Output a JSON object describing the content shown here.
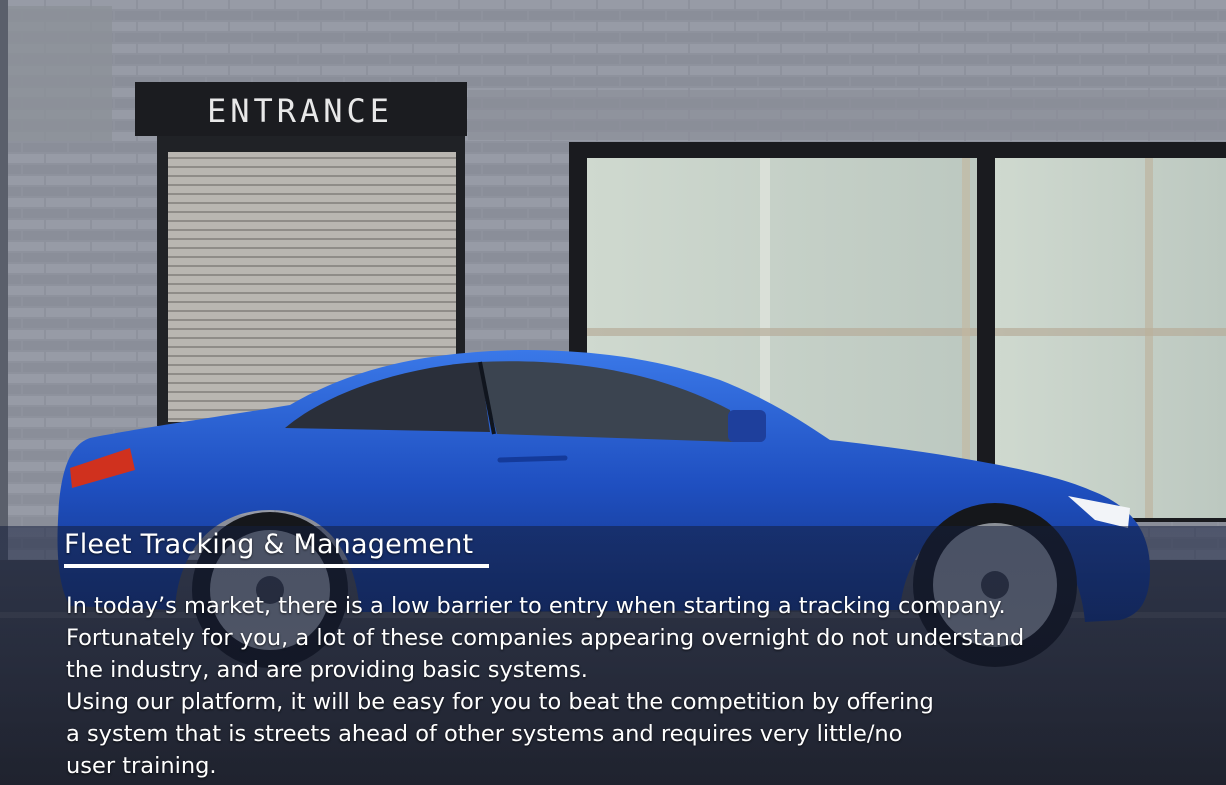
{
  "hero": {
    "image_alt": "Blue sports coupe parked in front of a brick building",
    "sign_text": "ENTRANCE"
  },
  "section": {
    "title": "Fleet Tracking & Management",
    "paragraphs": [
      "In today’s market, there is a low barrier to entry when starting a tracking company.",
      "Fortunately for you, a lot of these companies appearing overnight do not understand",
      "the industry, and are providing basic systems.",
      "Using our platform, it will be easy for you to beat the competition by offering",
      "a system that is streets ahead of other systems and requires very little/no",
      "user training."
    ]
  },
  "colors": {
    "car_blue": "#1f4fc0",
    "brick_wall": "#8e939e",
    "overlay": "#18203c",
    "text": "#ffffff"
  }
}
